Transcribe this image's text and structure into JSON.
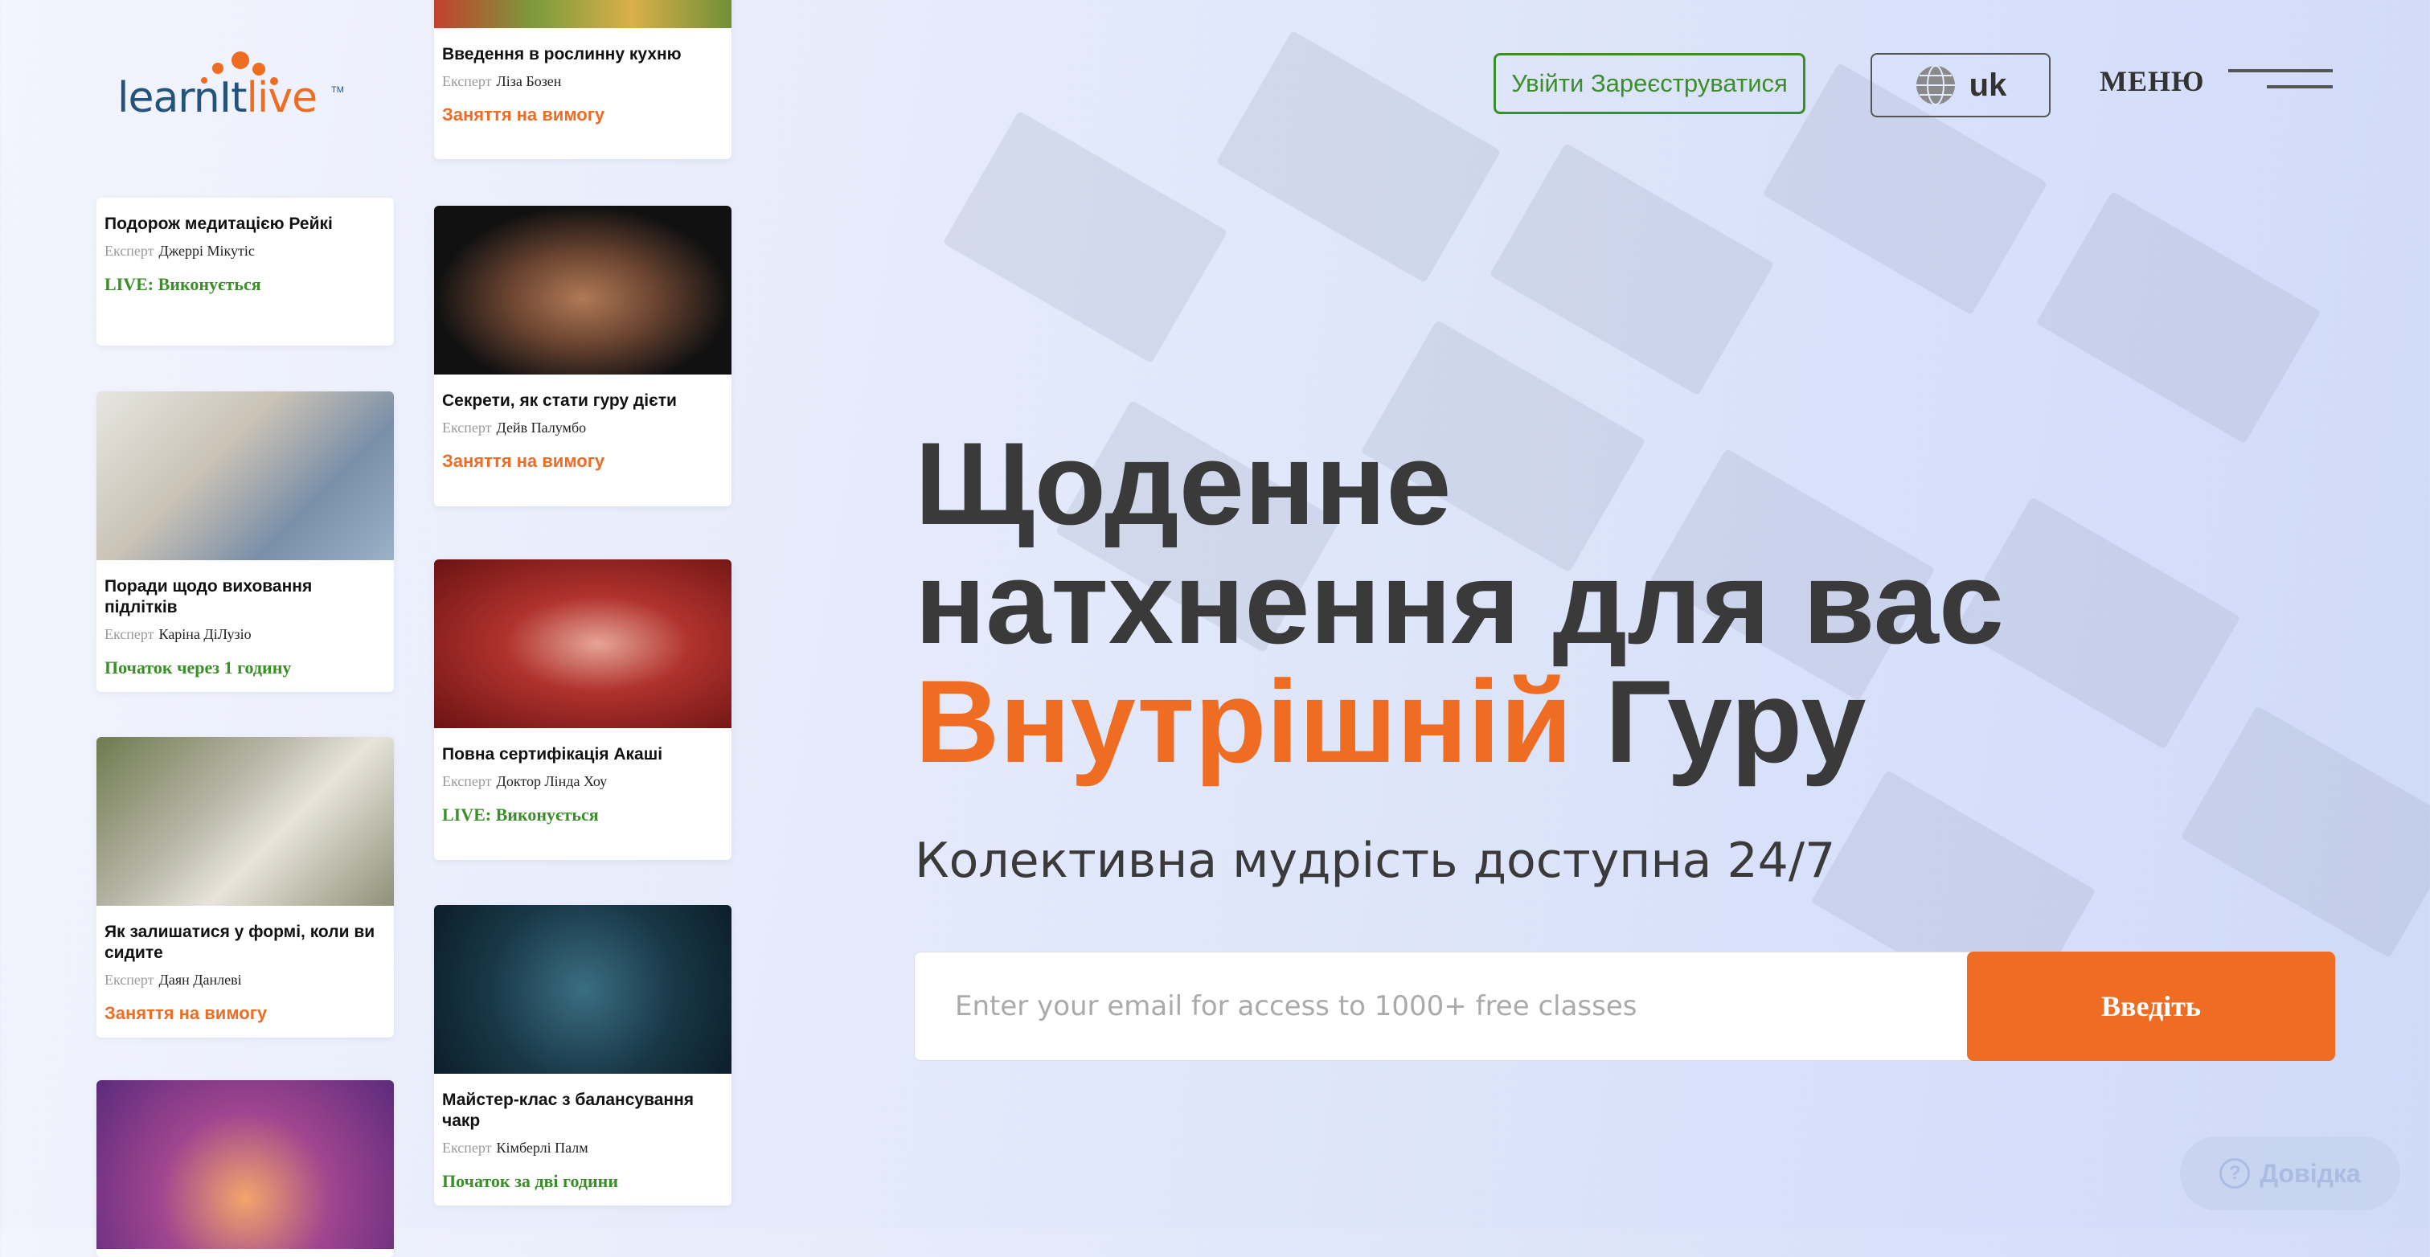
{
  "logo": {
    "part1": "learnIt",
    "part2": "live",
    "tm": "TM"
  },
  "header": {
    "login_label": "Увійти Зареєструватися",
    "lang_label": "uk",
    "menu_label": "МЕНЮ"
  },
  "hero": {
    "title_line1": "Щоденне",
    "title_line2": "натхнення для вас",
    "title_accent": "Внутрішній",
    "title_end": " Гуру",
    "subtitle": "Колективна мудрість доступна 24/7"
  },
  "email_form": {
    "placeholder": "Enter your email for access to 1000+ free classes",
    "submit_label": "Введіть"
  },
  "expert_label": "Експерт",
  "cards_left": [
    {
      "title": "Подорож медитацією Рейкі",
      "expert": "Джеррі Мікутіс",
      "status": "LIVE: Виконується",
      "status_type": "live"
    },
    {
      "title": "Поради щодо виховання підлітків",
      "expert": "Каріна ДіЛузіо",
      "status": "Початок через 1 годину",
      "status_type": "soon"
    },
    {
      "title": "Як залишатися у формі, коли ви сидите",
      "expert": "Даян Данлеві",
      "status": "Заняття на вимогу",
      "status_type": "ondemand"
    }
  ],
  "cards_right": [
    {
      "title": "Введення в рослинну кухню",
      "expert": "Ліза Бозен",
      "status": "Заняття на вимогу",
      "status_type": "ondemand"
    },
    {
      "title": "Секрети, як стати гуру дієти",
      "expert": "Дейв Палумбо",
      "status": "Заняття на вимогу",
      "status_type": "ondemand"
    },
    {
      "title": "Повна сертифікація Акаші",
      "expert": "Доктор Лінда Хоу",
      "status": "LIVE: Виконується",
      "status_type": "live"
    },
    {
      "title": "Майстер-клас з балансування чакр",
      "expert": "Кімберлі Палм",
      "status": "Початок за дві години",
      "status_type": "soon"
    }
  ],
  "help": {
    "label": "Довідка"
  },
  "colors": {
    "accent": "#ef6c23",
    "green": "#3b8e2a",
    "dark": "#3a3a3a"
  }
}
